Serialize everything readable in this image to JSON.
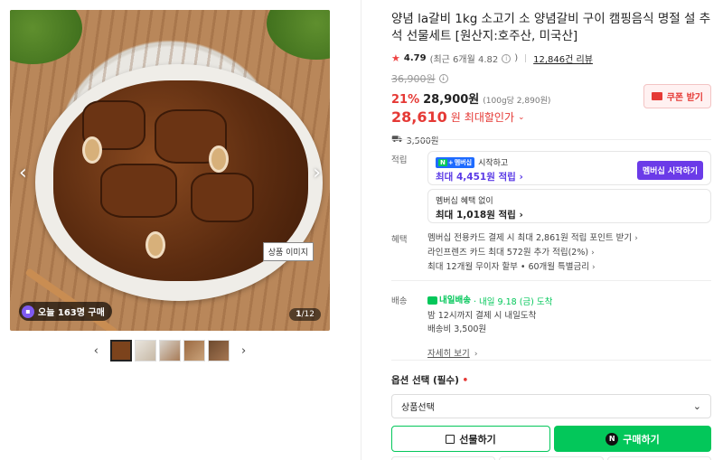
{
  "gallery": {
    "image_label": "상품 이미지",
    "buy_badge": "오늘 163명 구매",
    "counter_current": "1",
    "counter_total": "/12",
    "thumbnail_count": 5,
    "prev_arrow": "‹",
    "next_arrow": "›"
  },
  "product": {
    "title": "양념 la갈비 1kg 소고기 소 양념갈비 구이 캠핑음식 명절 설 추석 선물세트 [원산지:호주산, 미국산]",
    "rating": "4.79",
    "rating_note": "(최근 6개월 4.82",
    "rating_note_end": ")",
    "reviews": "12,846건 리뷰",
    "original_price": "36,900원",
    "discount_pct": "21%",
    "sale_price": "28,900원",
    "unit_price": "(100g당 2,890원)",
    "max_price": "28,610",
    "max_price_unit": "원",
    "max_label": "최대할인가",
    "coupon": "쿠폰 받기",
    "shipping_fee": "3,500원"
  },
  "points": {
    "label": "적립",
    "member_start": "시작하고",
    "npay_badge": "멤버십",
    "member_amount": "최대 4,451원 적립",
    "member_button": "멤버십 시작하기",
    "nonmember_label": "멤버십 혜택 없이",
    "nonmember_amount": "최대 1,018원 적립"
  },
  "benefits": {
    "label": "혜택",
    "items": [
      "멤버십 전용카드 결제 시 최대 2,861원 적립 포인트 받기",
      "라인프렌즈 카드 최대 572원 추가 적립(2%)",
      "최대 12개월 무이자 할부 • 60개월 특별금리"
    ]
  },
  "delivery": {
    "label": "배송",
    "badge": "내일배송",
    "eta": "· 내일 9.18 (금) 도착",
    "cutoff": "밤 12시까지 결제 시 내일도착",
    "fee": "배송비 3,500원",
    "more": "자세히 보기"
  },
  "option": {
    "title": "옵션 선택 (필수)",
    "required_mark": "•",
    "select_value": "상품선택"
  },
  "cta": {
    "gift": "선물하기",
    "buy": "구매하기",
    "buy_icon_letter": "N"
  },
  "colors": {
    "naver_green": "#03c75a",
    "sale_red": "#e53935",
    "member_purple": "#6b3be8"
  }
}
